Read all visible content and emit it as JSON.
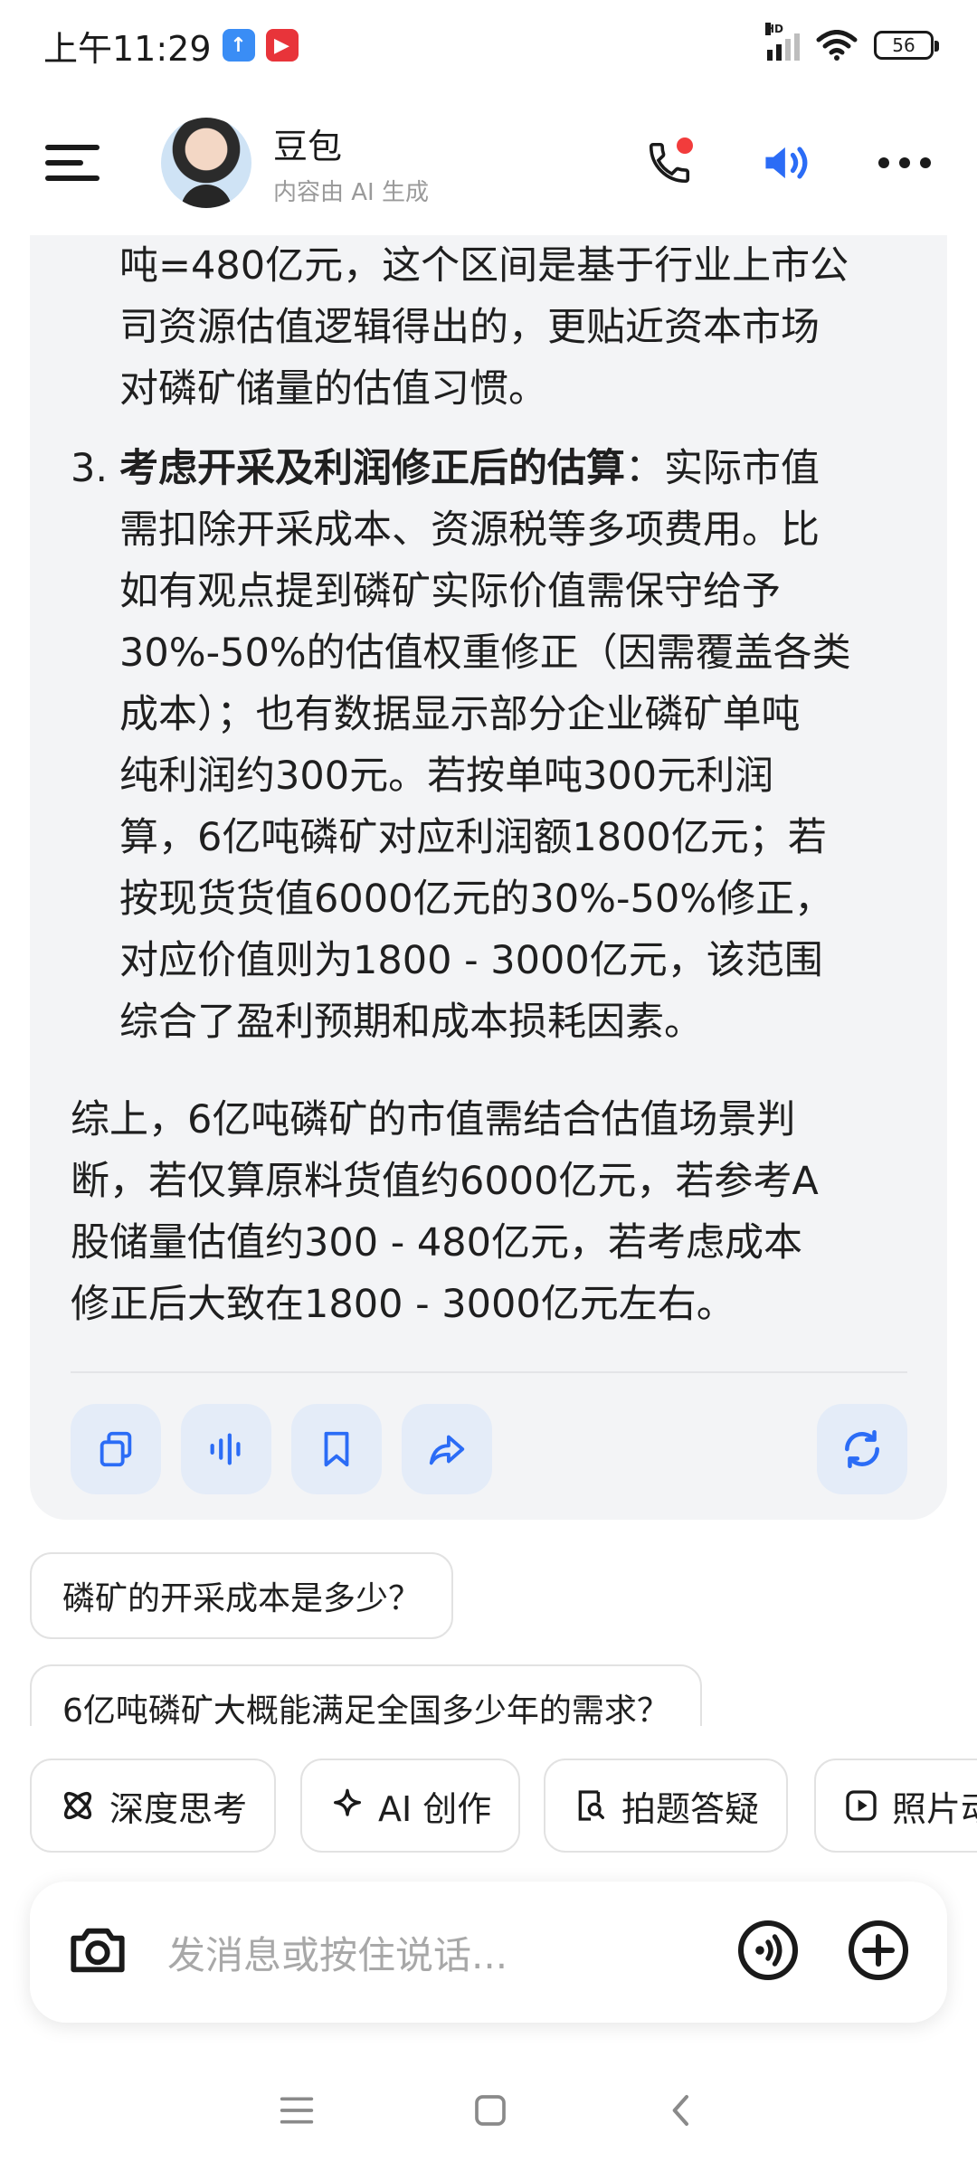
{
  "status_bar": {
    "time": "上午11:29",
    "hd_label": "HD",
    "battery": "56",
    "app_icon_colors": [
      "#3a8df5",
      "#e8343a"
    ]
  },
  "header": {
    "bot_name": "豆包",
    "bot_subtitle": "内容由 AI 生成",
    "icons": [
      "menu-icon",
      "phone-icon",
      "speaker-icon",
      "more-icon"
    ],
    "accent_color": "#2b6cf6"
  },
  "message": {
    "continued_lines": [
      "吨=480亿元，这个区间是基于行业上市公",
      "司资源估值逻辑得出的，更贴近资本市场",
      "对磷矿储量的估值习惯。"
    ],
    "item3": {
      "number": "3.",
      "bold": "考虑开采及利润修正后的估算",
      "lines": [
        "：实际市值",
        "需扣除开采成本、资源税等多项费用。比",
        "如有观点提到磷矿实际价值需保守给予",
        "30%-50%的估值权重修正（因需覆盖各类",
        "成本）；也有数据显示部分企业磷矿单吨",
        "纯利润约300元。若按单吨300元利润",
        "算，6亿吨磷矿对应利润额1800亿元；若",
        "按现货货值6000亿元的30%-50%修正，",
        "对应价值则为1800 - 3000亿元，该范围",
        "综合了盈利预期和成本损耗因素。"
      ]
    },
    "summary_lines": [
      "综上，6亿吨磷矿的市值需结合估值场景判",
      "断，若仅算原料货值约6000亿元，若参考A",
      "股储量估值约300 - 480亿元，若考虑成本",
      "修正后大致在1800 - 3000亿元左右。"
    ],
    "toolbar_icons": [
      "copy-icon",
      "voice-read-icon",
      "bookmark-icon",
      "share-icon",
      "regenerate-icon"
    ]
  },
  "suggestions": [
    "磷矿的开采成本是多少？",
    "6亿吨磷矿大概能满足全国多少年的需求？"
  ],
  "chips": [
    {
      "label": "深度思考",
      "icon": "atom-icon"
    },
    {
      "label": "AI 创作",
      "icon": "sparkle-icon"
    },
    {
      "label": "拍题答疑",
      "icon": "photo-search-icon"
    },
    {
      "label": "照片动",
      "icon": "play-icon"
    }
  ],
  "input": {
    "placeholder": "发消息或按住说话..."
  }
}
